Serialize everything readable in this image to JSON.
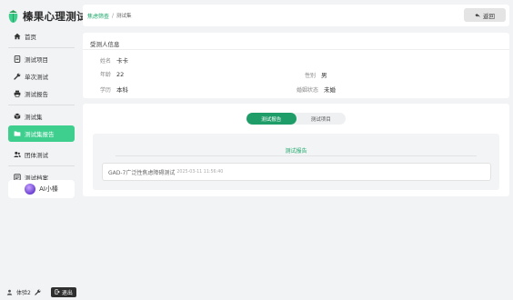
{
  "app": {
    "title": "榛果心理测试",
    "accent_color": "#3ecf8e",
    "logo_icon": "hazelnut-logo-icon"
  },
  "sidebar": {
    "items": [
      {
        "label": "首页",
        "icon": "home-icon",
        "active": false
      },
      {
        "label": "测试项目",
        "icon": "document-icon",
        "active": false
      },
      {
        "label": "单次测试",
        "icon": "wrench-icon",
        "active": false
      },
      {
        "label": "测试报告",
        "icon": "printer-icon",
        "active": false
      },
      {
        "label": "测试集",
        "icon": "cube-icon",
        "active": false
      },
      {
        "label": "测试集报告",
        "icon": "folder-icon",
        "active": true
      },
      {
        "label": "团体测试",
        "icon": "users-icon",
        "active": false
      },
      {
        "label": "测试档案",
        "icon": "archive-icon",
        "active": false
      }
    ],
    "ai_button_label": "AI小榛"
  },
  "footer": {
    "username": "体验2",
    "logout_label": "退出"
  },
  "header": {
    "breadcrumb_active": "焦虑筛查",
    "breadcrumb_current": "测试集",
    "back_label": "返回"
  },
  "subject": {
    "title": "受测人信息",
    "name_label": "姓名",
    "name_value": "卡卡",
    "age_label": "年龄",
    "age_value": "22",
    "gender_label": "性别",
    "gender_value": "男",
    "education_label": "学历",
    "education_value": "本科",
    "marital_label": "婚姻状态",
    "marital_value": "未婚"
  },
  "report": {
    "tabs": [
      {
        "label": "测试报告",
        "active": true
      },
      {
        "label": "测试项目",
        "active": false
      }
    ],
    "heading": "测试报告",
    "items": [
      {
        "name": "GAD-7广泛性焦虑障碍测试",
        "time": "2025-03-11 11:56:40"
      }
    ]
  }
}
